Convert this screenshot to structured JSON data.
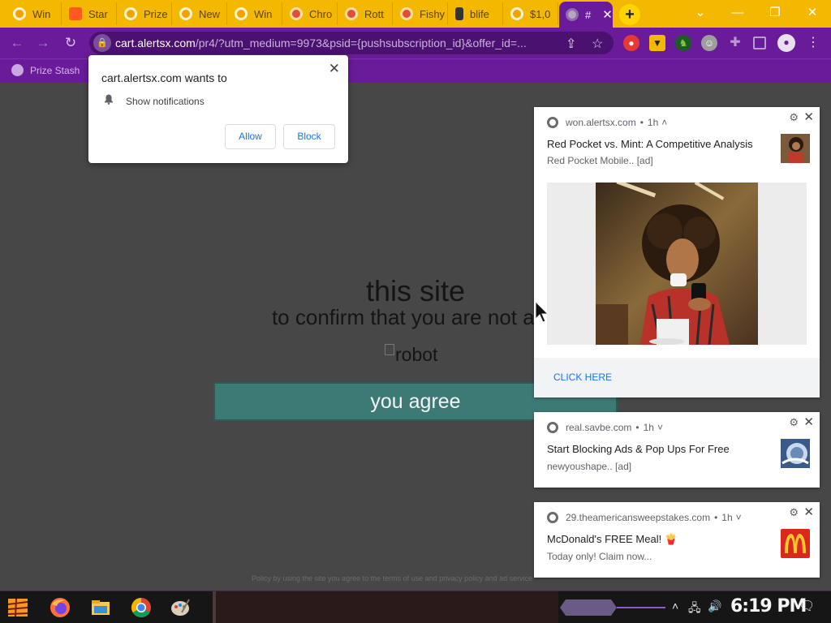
{
  "tabs": [
    {
      "label": "Win",
      "icon": "chrome-icon",
      "color": "#f5a000"
    },
    {
      "label": "Star",
      "icon": "brave-icon",
      "color": "#ff5a1f"
    },
    {
      "label": "Prize",
      "icon": "chrome-icon",
      "color": "#f5a000"
    },
    {
      "label": "New",
      "icon": "chrome-icon",
      "color": "#f5a000"
    },
    {
      "label": "Win",
      "icon": "chrome-icon",
      "color": "#f5a000"
    },
    {
      "label": "Chro",
      "icon": "chrome-icon",
      "color": "#e24c3c"
    },
    {
      "label": "Rott",
      "icon": "chrome-icon",
      "color": "#e24c3c"
    },
    {
      "label": "Fishy",
      "icon": "chrome-icon",
      "color": "#e24c3c"
    },
    {
      "label": "blife",
      "icon": "phone-icon",
      "color": "#333333"
    },
    {
      "label": "$1,0",
      "icon": "chrome-icon",
      "color": "#f5a000"
    },
    {
      "label": "#",
      "icon": "chrome-icon",
      "color": "#b7a4c6"
    }
  ],
  "active_tab_close": "✕",
  "new_tab": "+",
  "window_controls": {
    "dropdown": "⌄",
    "minimize": "—",
    "restore": "❐",
    "close": "✕"
  },
  "address_bar": {
    "host": "cart.alertsx.com",
    "path": "/pr4/?utm_medium=9973&psid={pushsubscription_id}&offer_id=..."
  },
  "bookmarks": [
    {
      "label": "Prize Stash"
    }
  ],
  "page": {
    "heading": "this site",
    "subheading": "to confirm that you are not a ro",
    "image_alt": "robot",
    "agree_button": "you agree",
    "footer": "Policy by using the site you agree to the terms of use and privacy policy and ad service"
  },
  "permission_prompt": {
    "title": "cart.alertsx.com wants to",
    "permission": "Show notifications",
    "allow": "Allow",
    "block": "Block"
  },
  "notifications": [
    {
      "source": "won.alertsx.com",
      "time": "1h",
      "title": "Red Pocket vs. Mint: A Competitive Analysis",
      "body": "Red Pocket Mobile.. [ad]",
      "action": "CLICK HERE"
    },
    {
      "source": "real.savbe.com",
      "time": "1h",
      "title": "Start Blocking Ads & Pop Ups For Free",
      "body": "newyoushape.. [ad]"
    },
    {
      "source": "29.theamericansweepstakes.com",
      "time": "1h",
      "title": "McDonald's FREE Meal! 🍟",
      "body": "Today only! Claim now..."
    }
  ],
  "taskbar": {
    "clock": "6:19 PM"
  },
  "colors": {
    "tab_strip": "#f5b800",
    "browser_frame": "#6a1b9a",
    "page_bg": "#474747",
    "agree_button": "#3d7a76",
    "link_blue": "#1a73e8"
  }
}
